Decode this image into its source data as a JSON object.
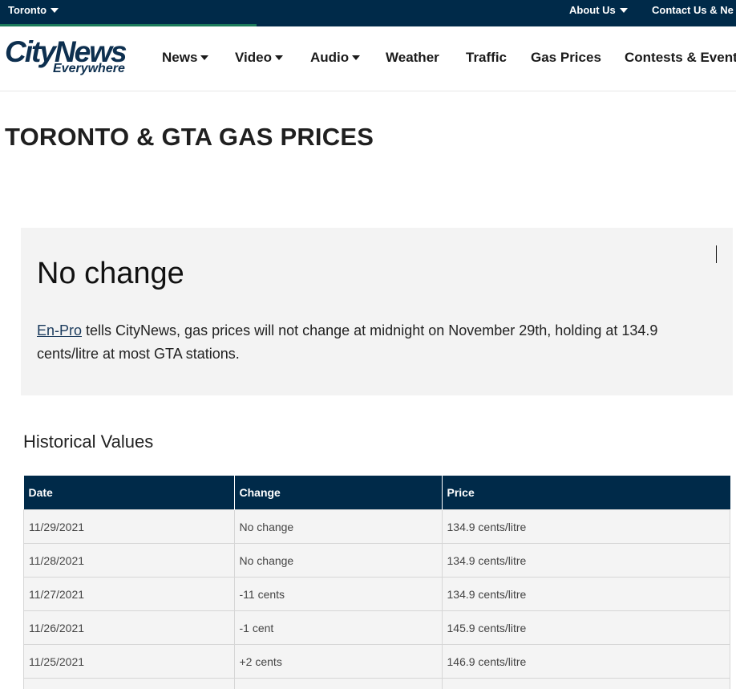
{
  "topbar": {
    "location": "Toronto",
    "about": "About Us",
    "contact": "Contact Us & Ne"
  },
  "logo": {
    "main": "CityNews",
    "sub": "Everywhere"
  },
  "nav": [
    {
      "label": "News",
      "dropdown": true
    },
    {
      "label": "Video",
      "dropdown": true
    },
    {
      "label": "Audio",
      "dropdown": true
    },
    {
      "label": "Weather",
      "dropdown": false
    },
    {
      "label": "Traffic",
      "dropdown": false
    },
    {
      "label": "Gas Prices",
      "dropdown": false
    },
    {
      "label": "Contests & Events",
      "dropdown": false
    }
  ],
  "page_title": "TORONTO & GTA GAS PRICES",
  "callout": {
    "heading": "No change",
    "link_text": "En-Pro",
    "body": " tells CityNews, gas prices will not change at midnight on November 29th, holding at 134.9 cents/litre at most GTA stations."
  },
  "historical": {
    "title": "Historical Values",
    "columns": [
      "Date",
      "Change",
      "Price"
    ],
    "rows": [
      [
        "11/29/2021",
        "No change",
        "134.9 cents/litre"
      ],
      [
        "11/28/2021",
        "No change",
        "134.9 cents/litre"
      ],
      [
        "11/27/2021",
        "-11 cents",
        "134.9 cents/litre"
      ],
      [
        "11/26/2021",
        "-1 cent",
        "145.9 cents/litre"
      ],
      [
        "11/25/2021",
        "+2 cents",
        "146.9 cents/litre"
      ],
      [
        "",
        "",
        ""
      ]
    ]
  }
}
